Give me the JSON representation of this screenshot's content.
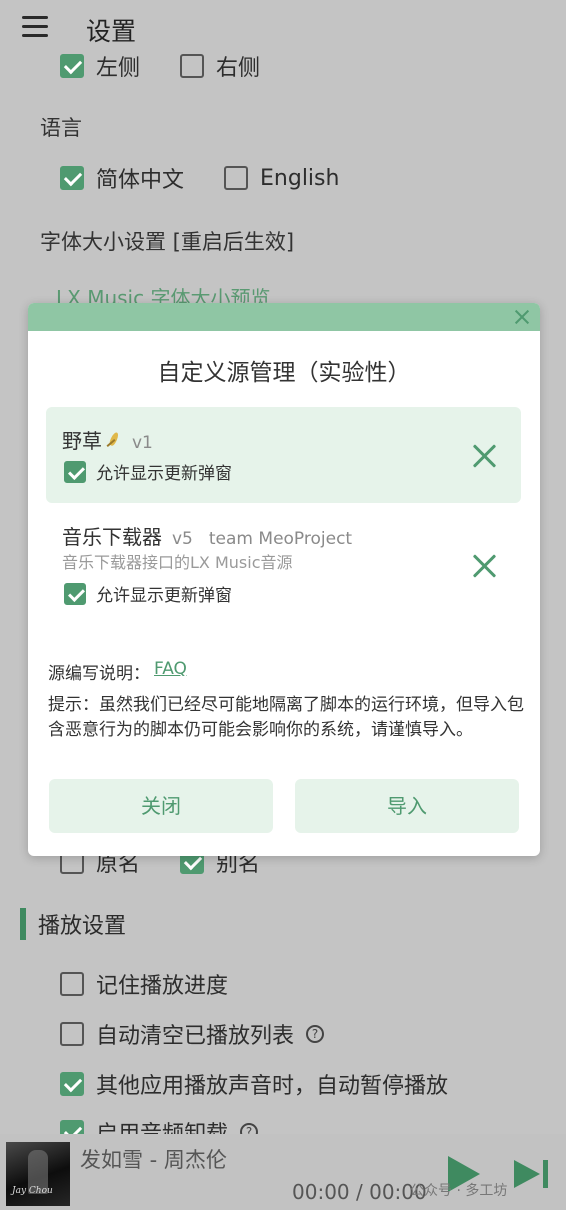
{
  "header": {
    "title": "设置"
  },
  "settings": {
    "position_row": {
      "left": "左侧",
      "right": "右侧",
      "left_checked": true,
      "right_checked": false
    },
    "language_label": "语言",
    "language": {
      "zh": "简体中文",
      "en": "English",
      "zh_checked": true,
      "en_checked": false
    },
    "font_size_label": "字体大小设置 [重启后生效]",
    "font_preview": "LX Music 字体大小预览",
    "name_row": {
      "original": "原名",
      "alias": "别名",
      "original_checked": false,
      "alias_checked": true
    },
    "playback_section": "播放设置",
    "playback": [
      {
        "label": "记住播放进度",
        "checked": false,
        "help": false
      },
      {
        "label": "自动清空已播放列表",
        "checked": false,
        "help": true
      },
      {
        "label": "其他应用播放声音时，自动暂停播放",
        "checked": true,
        "help": false
      },
      {
        "label": "启用音频卸载",
        "checked": true,
        "help": true
      }
    ],
    "help_glyph": "?"
  },
  "dialog": {
    "title": "自定义源管理（实验性）",
    "sources": [
      {
        "name": "野草",
        "version": "v1",
        "author": "",
        "description": "",
        "allow_update": "允许显示更新弹窗",
        "checked": true
      },
      {
        "name": "音乐下载器",
        "version": "v5",
        "author": "team MeoProject",
        "description": "音乐下载器接口的LX Music音源",
        "allow_update": "允许显示更新弹窗",
        "checked": true
      }
    ],
    "doc_label": "源编写说明：",
    "faq_link": "FAQ",
    "tip": "提示：虽然我们已经尽可能地隔离了脚本的运行环境，但导入包含恶意行为的脚本仍可能会影响你的系统，请谨慎导入。",
    "close_button": "关闭",
    "import_button": "导入"
  },
  "player": {
    "song": "发如雪 - 周杰伦",
    "time": "00:00 / 00:00",
    "album_text": "Jay Chou"
  },
  "watermark": "公众号 · 多工坊",
  "colors": {
    "accent": "#4f9a70",
    "dialog_bar": "#8fc6a4",
    "active_bg": "#e6f3ea"
  }
}
